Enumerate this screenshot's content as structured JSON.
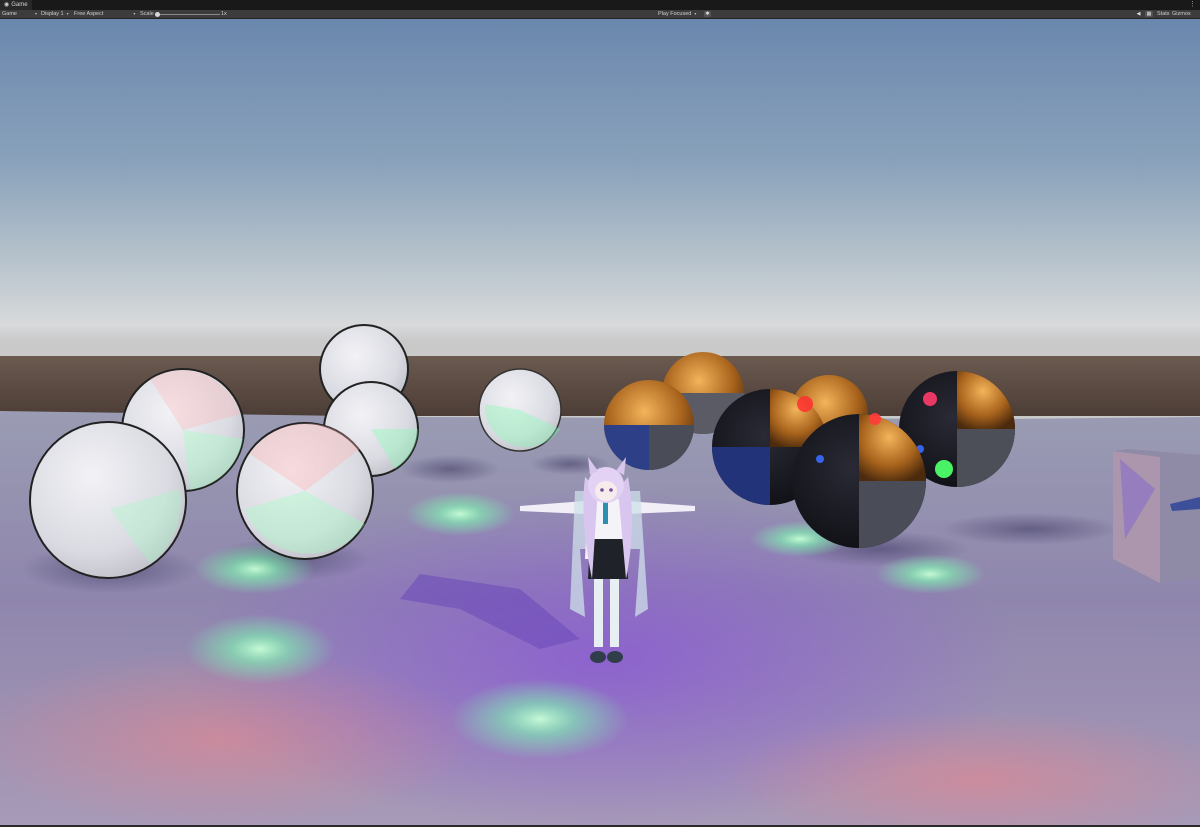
{
  "window": {
    "tab_title": "Game",
    "tab_icon": "game-controller-icon",
    "more_icon": "⋮"
  },
  "toolbar": {
    "mode_dropdown": "Game",
    "display_dropdown": "Display 1",
    "aspect_dropdown": "Free Aspect",
    "scale_label": "Scale",
    "scale_value": "1x",
    "play_mode_dropdown": "Play Focused",
    "stats_label": "Stats",
    "gizmos_label": "Gizmos",
    "dropdown_arrow": "▾"
  },
  "scene": {
    "sky_top": "#6a87ad",
    "horizon": "#d8dadb",
    "floor": "#8d87a8",
    "far_wall": "#5a4a42",
    "accent_glow": "#7dffb0",
    "purple_tint": "#8a5fd0"
  }
}
